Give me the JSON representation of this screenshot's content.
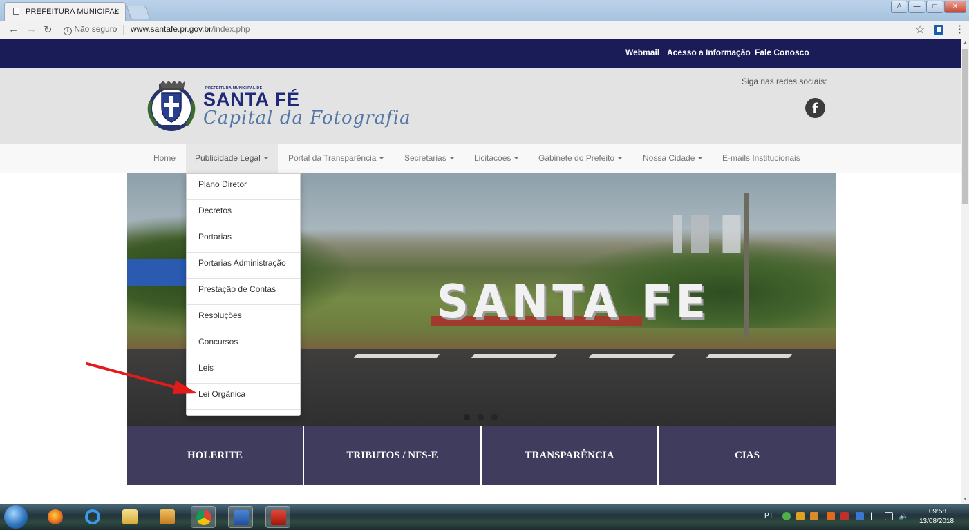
{
  "browser": {
    "tab_title": "PREFEITURA MUNICIPAL",
    "tab_close": "×",
    "security_label": "Não seguro",
    "url_host": "www.santafe.pr.gov.br",
    "url_path": "/index.php"
  },
  "topnav": {
    "links": [
      "Webmail",
      "Acesso a Informação",
      "Fale Conosco"
    ]
  },
  "header": {
    "logo_small": "PREFEITURA MUNICIPAL DE",
    "logo_title": "SANTA FÉ",
    "logo_script": "Capital da Fotografia",
    "social_label": "Siga nas redes sociais:",
    "facebook_glyph": "f"
  },
  "mainnav": {
    "items": [
      {
        "label": "Home"
      },
      {
        "label": "Publicidade Legal"
      },
      {
        "label": "Portal da Transparência"
      },
      {
        "label": "Secretarias"
      },
      {
        "label": "Licitacoes"
      },
      {
        "label": "Gabinete do Prefeito"
      },
      {
        "label": "Nossa Cidade"
      },
      {
        "label": "E-mails Institucionais"
      }
    ]
  },
  "dropdown": {
    "items": [
      "Plano Diretor",
      "Decretos",
      "Portarias",
      "Portarias Administração",
      "Prestação de Contas",
      "Resoluções",
      "Concursos",
      "Leis",
      "Lei Orgânica"
    ]
  },
  "hero": {
    "sign_text": "SANTA FE",
    "slide_count": 3,
    "active_slide": 1
  },
  "tiles": [
    "HOLERITE",
    "TRIBUTOS / NFS-E",
    "TRANSPARÊNCIA",
    "CIAS"
  ],
  "taskbar": {
    "language": "PT",
    "time": "09:58",
    "date": "13/08/2018"
  },
  "colors": {
    "topnav_bg": "#1a1c57",
    "header_bg": "#e3e3e3",
    "tile_bg": "#403c5e",
    "arrow": "#e21b1b",
    "logo_blue": "#1e2a78"
  }
}
